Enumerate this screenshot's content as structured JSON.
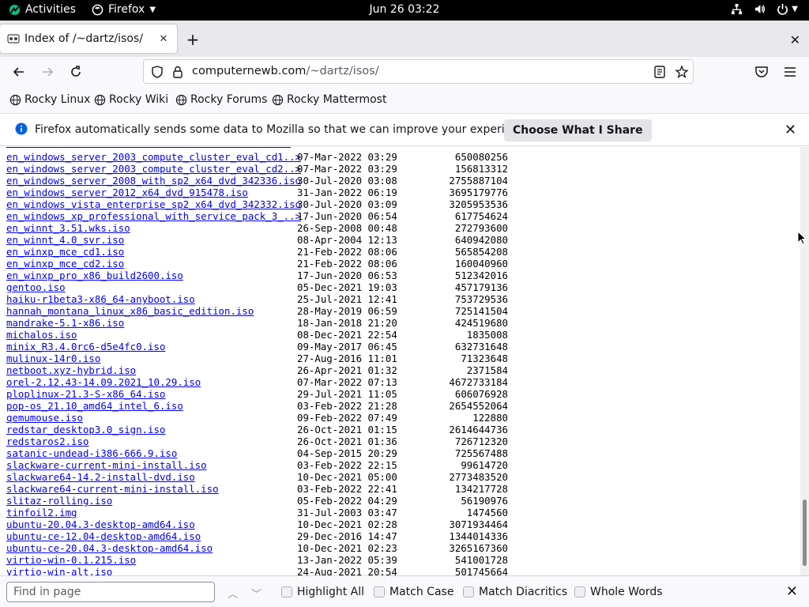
{
  "topbar": {
    "activities": "Activities",
    "app": "Firefox",
    "clock": "Jun 26  03:22",
    "icons": [
      "network-icon",
      "volume-icon",
      "power-icon"
    ]
  },
  "tab": {
    "title": "Index of /~dartz/isos/"
  },
  "urlbar": {
    "domain": "computernewb.com",
    "path": "/~dartz/isos/"
  },
  "bookmarks": [
    "Rocky Linux",
    "Rocky Wiki",
    "Rocky Forums",
    "Rocky Mattermost"
  ],
  "notification": {
    "message": "Firefox automatically sends some data to Mozilla so that we can improve your experience.",
    "button": "Choose What I Share"
  },
  "listing": [
    {
      "name": "en_windows_server_2003_compute_cluster_eval_cd1..>",
      "date": "07-Mar-2022 03:29",
      "size": "650080256"
    },
    {
      "name": "en_windows_server_2003_compute_cluster_eval_cd2..>",
      "date": "07-Mar-2022 03:29",
      "size": "156813312"
    },
    {
      "name": "en_windows_server_2008_with_sp2_x64_dvd_342336.iso",
      "date": "30-Jul-2020 03:08",
      "size": "2755887104"
    },
    {
      "name": "en_windows_server_2012_x64_dvd_915478.iso",
      "date": "31-Jan-2022 06:19",
      "size": "3695179776"
    },
    {
      "name": "en_windows_vista_enterprise_sp2_x64_dvd_342332.iso",
      "date": "30-Jul-2020 03:09",
      "size": "3205953536"
    },
    {
      "name": "en_windows_xp_professional_with_service_pack_3_..>",
      "date": "17-Jun-2020 06:54",
      "size": "617754624"
    },
    {
      "name": "en_winnt_3.51.wks.iso",
      "date": "26-Sep-2008 00:48",
      "size": "272793600"
    },
    {
      "name": "en_winnt_4.0_svr.iso",
      "date": "08-Apr-2004 12:13",
      "size": "640942080"
    },
    {
      "name": "en_winxp_mce_cd1.iso",
      "date": "21-Feb-2022 08:06",
      "size": "565854208"
    },
    {
      "name": "en_winxp_mce_cd2.iso",
      "date": "21-Feb-2022 08:06",
      "size": "160040960"
    },
    {
      "name": "en_winxp_pro_x86_build2600.iso",
      "date": "17-Jun-2020 06:53",
      "size": "512342016"
    },
    {
      "name": "gentoo.iso",
      "date": "05-Dec-2021 19:03",
      "size": "457179136"
    },
    {
      "name": "haiku-r1beta3-x86_64-anyboot.iso",
      "date": "25-Jul-2021 12:41",
      "size": "753729536"
    },
    {
      "name": "hannah_montana_linux_x86_basic_edition.iso",
      "date": "28-May-2019 06:59",
      "size": "725141504"
    },
    {
      "name": "mandrake-5.1-x86.iso",
      "date": "18-Jan-2018 21:20",
      "size": "424519680"
    },
    {
      "name": "michalos.iso",
      "date": "08-Dec-2021 22:54",
      "size": "1835008"
    },
    {
      "name": "minix_R3.4.0rc6-d5e4fc0.iso",
      "date": "09-May-2017 06:45",
      "size": "632731648"
    },
    {
      "name": "mulinux-14r0.iso",
      "date": "27-Aug-2016 11:01",
      "size": "71323648"
    },
    {
      "name": "netboot.xyz-hybrid.iso",
      "date": "26-Apr-2021 01:32",
      "size": "2371584"
    },
    {
      "name": "orel-2.12.43-14.09.2021_10.29.iso",
      "date": "07-Mar-2022 07:13",
      "size": "4672733184"
    },
    {
      "name": "ploplinux-21.3-S-x86_64.iso",
      "date": "29-Jul-2021 11:05",
      "size": "606076928"
    },
    {
      "name": "pop-os_21.10_amd64_intel_6.iso",
      "date": "03-Feb-2022 21:28",
      "size": "2654552064"
    },
    {
      "name": "qemumouse.iso",
      "date": "09-Feb-2022 07:49",
      "size": "122880"
    },
    {
      "name": "redstar_desktop3.0_sign.iso",
      "date": "26-Oct-2021 01:15",
      "size": "2614644736"
    },
    {
      "name": "redstaros2.iso",
      "date": "26-Oct-2021 01:36",
      "size": "726712320"
    },
    {
      "name": "satanic-undead-i386-666.9.iso",
      "date": "04-Sep-2015 20:29",
      "size": "725567488"
    },
    {
      "name": "slackware-current-mini-install.iso",
      "date": "03-Feb-2022 22:15",
      "size": "99614720"
    },
    {
      "name": "slackware64-14.2-install-dvd.iso",
      "date": "10-Dec-2021 05:00",
      "size": "2773483520"
    },
    {
      "name": "slackware64-current-mini-install.iso",
      "date": "03-Feb-2022 22:41",
      "size": "134217728"
    },
    {
      "name": "slitaz-rolling.iso",
      "date": "05-Feb-2022 04:29",
      "size": "56190976"
    },
    {
      "name": "tinfoil2.img",
      "date": "31-Jul-2003 03:47",
      "size": "1474560"
    },
    {
      "name": "ubuntu-20.04.3-desktop-amd64.iso",
      "date": "10-Dec-2021 02:28",
      "size": "3071934464"
    },
    {
      "name": "ubuntu-ce-12.04-desktop-amd64.iso",
      "date": "29-Dec-2016 14:47",
      "size": "1344014336"
    },
    {
      "name": "ubuntu-ce-20.04.3-desktop-amd64.iso",
      "date": "10-Dec-2021 02:23",
      "size": "3265167360"
    },
    {
      "name": "virtio-win-0.1.215.iso",
      "date": "13-Jan-2022 05:39",
      "size": "541001728"
    },
    {
      "name": "virtio-win-alt.iso",
      "date": "24-Aug-2021 20:54",
      "size": "501745664"
    }
  ],
  "findbar": {
    "placeholder": "Find in page",
    "highlight_all": "Highlight All",
    "match_case": "Match Case",
    "match_diacritics": "Match Diacritics",
    "whole_words": "Whole Words"
  }
}
